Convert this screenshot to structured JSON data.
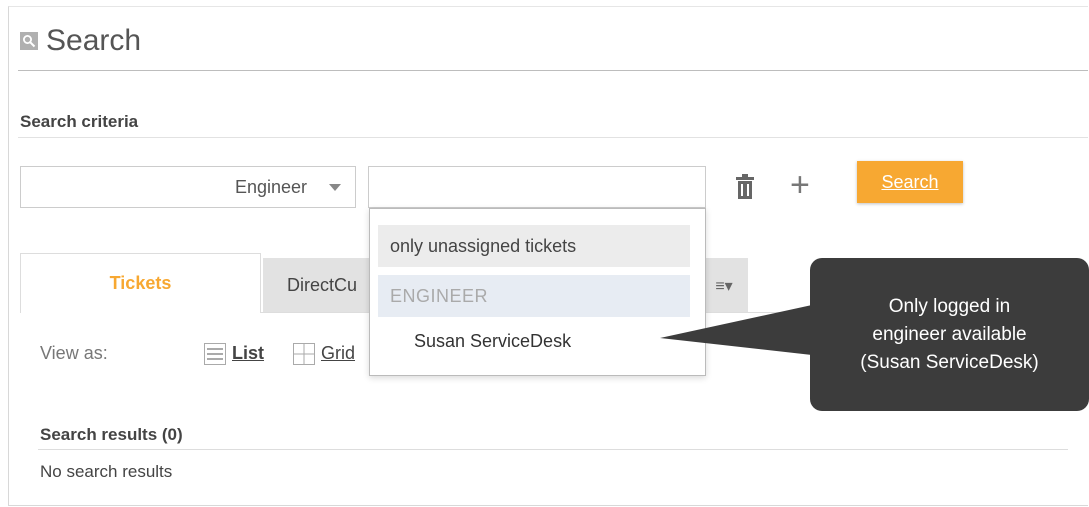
{
  "page": {
    "title": "Search",
    "title_icon": "search-icon"
  },
  "criteria": {
    "label": "Search criteria",
    "field_selected": "Engineer",
    "value_input": "",
    "delete_icon": "trash-icon",
    "add_icon": "plus-icon",
    "add_label": "+",
    "search_button": "Search"
  },
  "tabs": [
    {
      "label": "Tickets",
      "active": true
    },
    {
      "label": "DirectCu",
      "active": false
    }
  ],
  "view_as": {
    "label": "View as:",
    "list": "List",
    "grid": "Grid"
  },
  "results": {
    "title": "Search results (0)",
    "empty": "No search results"
  },
  "dropdown": {
    "unassigned": "only unassigned tickets",
    "group_header": "ENGINEER",
    "items": [
      "Susan ServiceDesk"
    ]
  },
  "callout": {
    "text": "Only logged in\nengineer available\n(Susan ServiceDesk)"
  },
  "colors": {
    "accent": "#f7a832",
    "callout_bg": "#3c3c3c",
    "group_bg": "#e7ecf3"
  }
}
